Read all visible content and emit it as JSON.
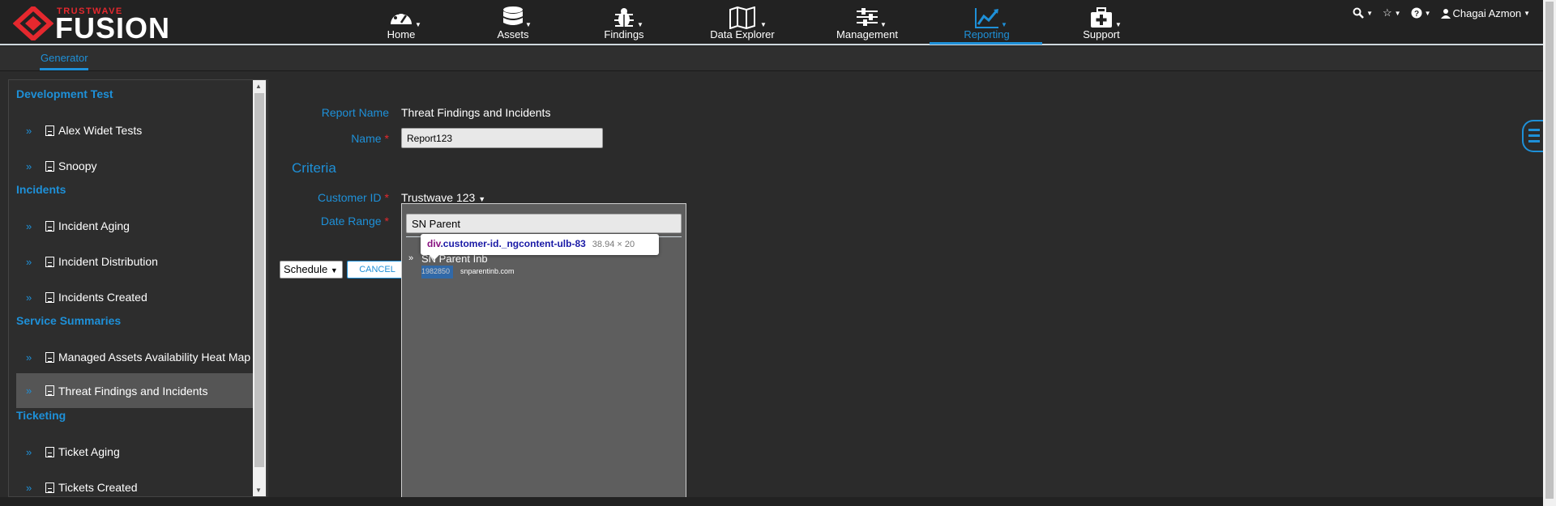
{
  "brand": {
    "small": "TRUSTWAVE",
    "big": "FUSION",
    "accent": "#e5282e"
  },
  "colors": {
    "accent": "#1e90d8",
    "required": "#e5282e"
  },
  "nav": {
    "items": [
      {
        "label": "Home",
        "icon": "dashboard-icon"
      },
      {
        "label": "Assets",
        "icon": "database-icon"
      },
      {
        "label": "Findings",
        "icon": "bug-icon"
      },
      {
        "label": "Data Explorer",
        "icon": "map-icon"
      },
      {
        "label": "Management",
        "icon": "sliders-icon"
      },
      {
        "label": "Reporting",
        "icon": "chart-line-icon",
        "active": true
      },
      {
        "label": "Support",
        "icon": "first-aid-kit-icon"
      }
    ]
  },
  "topright": {
    "user": "Chagai Azmon"
  },
  "subnav": {
    "tab": "Generator"
  },
  "sidebar": {
    "groups": [
      {
        "title": "Development Test",
        "items": [
          "Alex Widet Tests",
          "Snoopy"
        ]
      },
      {
        "title": "Incidents",
        "items": [
          "Incident Aging",
          "Incident Distribution",
          "Incidents Created"
        ]
      },
      {
        "title": "Service Summaries",
        "items": [
          "Managed Assets Availability Heat Map",
          "Threat Findings and Incidents"
        ]
      },
      {
        "title": "Ticketing",
        "items": [
          "Ticket Aging",
          "Tickets Created"
        ]
      }
    ],
    "selected": "Threat Findings and Incidents"
  },
  "form": {
    "report_name_label": "Report Name",
    "report_name_value": "Threat Findings and Incidents",
    "name_label": "Name",
    "name_value": "Report123",
    "criteria_title": "Criteria",
    "customer_id_label": "Customer ID",
    "customer_id_value": "Trustwave 123",
    "date_range_label": "Date Range",
    "required_mark": "*",
    "schedule_label": "Schedule",
    "cancel_label": "CANCEL"
  },
  "dropdown": {
    "search_value": "SN Parent",
    "item_name": "SN Parent Inb",
    "item_id": "1982850",
    "item_host": "snparentinb.com"
  },
  "devtools_tip": {
    "tag": "div",
    "selector": ".customer-id._ngcontent-ulb-83",
    "dims": "38.94 × 20"
  }
}
